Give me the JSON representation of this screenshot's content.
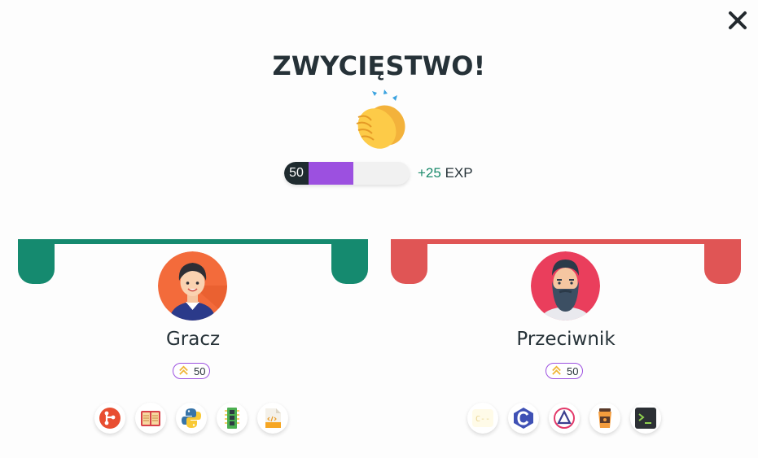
{
  "modal": {
    "title": "ZWYCIĘSTWO!",
    "close_icon": "close-icon",
    "celebration_icon": "clapping-hands-icon"
  },
  "progress": {
    "level": "50",
    "fill_fraction": 0.45,
    "fill_color": "#9c50e0",
    "exp_gain_amount": "+25",
    "exp_gain_unit": "EXP"
  },
  "player": {
    "name": "Gracz",
    "level": "50",
    "color": "#158a6f",
    "avatar": "boy-avatar",
    "skills": [
      "git-icon",
      "book-icon",
      "python-icon",
      "memory-chip-icon",
      "xml-file-icon"
    ]
  },
  "opponent": {
    "name": "Przeciwnik",
    "level": "50",
    "color": "#e05555",
    "avatar": "bearded-man-avatar",
    "skills": [
      "c-minus-minus-icon",
      "c-language-icon",
      "delta-icon",
      "coffee-cup-icon",
      "terminal-icon"
    ]
  }
}
